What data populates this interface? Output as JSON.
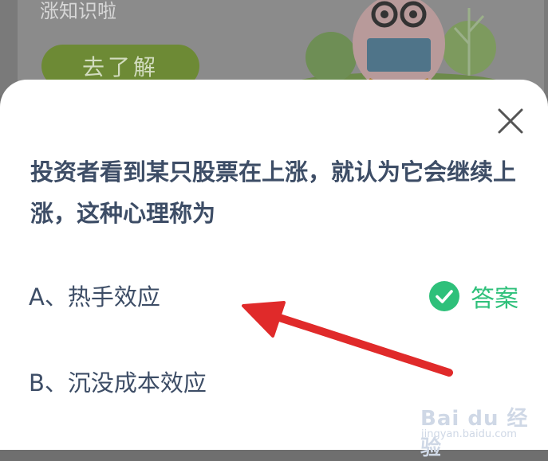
{
  "banner": {
    "subtitle": "涨知识啦",
    "button_label": "去了解"
  },
  "dialog": {
    "question": "投资者看到某只股票在上涨，就认为它会继续上涨，这种心理称为",
    "options": [
      {
        "label": "A、热手效应"
      },
      {
        "label": "B、沉没成本效应"
      }
    ],
    "answer_label": "答案",
    "close_icon": "close-icon",
    "answer_icon": "check-circle-icon"
  },
  "colors": {
    "question_text": "#3d4d66",
    "answer_green": "#2ec07a",
    "arrow_red": "#e02a2a",
    "banner_button": "#6d8a35"
  },
  "watermark": {
    "brand": "Bai du 经验",
    "url": "jingyan.baidu.com"
  }
}
